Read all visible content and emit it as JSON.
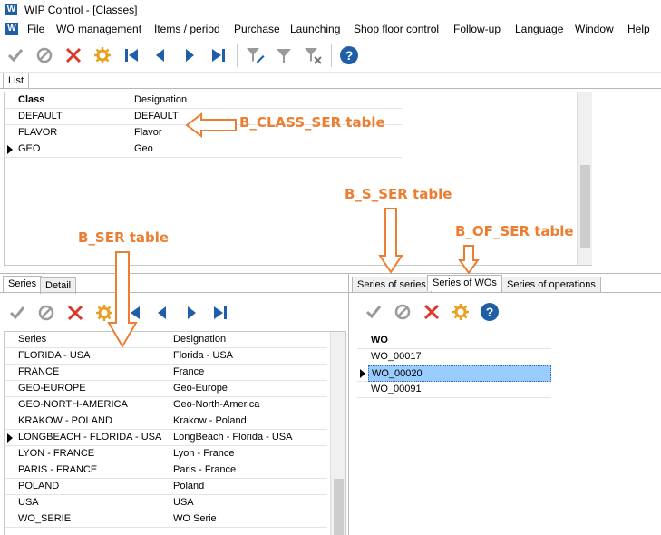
{
  "window": {
    "title": "WIP Control - [Classes]",
    "logo_letter": "W"
  },
  "menubar": [
    {
      "label": "File"
    },
    {
      "label": "WO management"
    },
    {
      "label": "Items / period"
    },
    {
      "label": "Purchase"
    },
    {
      "label": "Launching"
    },
    {
      "label": "Shop floor control"
    },
    {
      "label": "Follow-up"
    },
    {
      "label": "Language"
    },
    {
      "label": "Window"
    },
    {
      "label": "Help"
    }
  ],
  "top_tab": "List",
  "classes_table": {
    "columns": [
      "Class",
      "Designation"
    ],
    "rows": [
      {
        "class": "DEFAULT",
        "designation": "DEFAULT"
      },
      {
        "class": "FLAVOR",
        "designation": "Flavor"
      },
      {
        "class": "GEO",
        "designation": "Geo"
      }
    ],
    "current_row": 2
  },
  "left_tabs": [
    "Series",
    "Detail"
  ],
  "series_table": {
    "columns": [
      "Series",
      "Designation"
    ],
    "rows": [
      {
        "series": "FLORIDA - USA",
        "designation": "Florida - USA"
      },
      {
        "series": "FRANCE",
        "designation": "France"
      },
      {
        "series": "GEO-EUROPE",
        "designation": "Geo-Europe"
      },
      {
        "series": "GEO-NORTH-AMERICA",
        "designation": "Geo-North-America"
      },
      {
        "series": "KRAKOW - POLAND",
        "designation": "Krakow - Poland"
      },
      {
        "series": "LONGBEACH - FLORIDA - USA",
        "designation": "LongBeach - Florida - USA"
      },
      {
        "series": "LYON - FRANCE",
        "designation": "Lyon - France"
      },
      {
        "series": "PARIS - FRANCE",
        "designation": "Paris - France"
      },
      {
        "series": "POLAND",
        "designation": "Poland"
      },
      {
        "series": "USA",
        "designation": "USA"
      },
      {
        "series": "WO_SERIE",
        "designation": "WO Serie"
      }
    ],
    "current_row": 5
  },
  "right_tabs": [
    "Series of series",
    "Series of WOs",
    "Series of operations"
  ],
  "wo_table": {
    "columns": [
      "WO"
    ],
    "rows": [
      "WO_00017",
      "WO_00020",
      "WO_00091"
    ],
    "current_row": 1
  },
  "annotations": {
    "b_class_ser": "B_CLASS_SER table",
    "b_s_ser": "B_S_SER table",
    "b_of_ser": "B_OF_SER table",
    "b_ser": "B_SER table"
  },
  "colors": {
    "accent_orange": "#ed7d31",
    "selection": "#99ccff",
    "icon_blue": "#1f5fa8",
    "icon_red": "#d9382a"
  }
}
